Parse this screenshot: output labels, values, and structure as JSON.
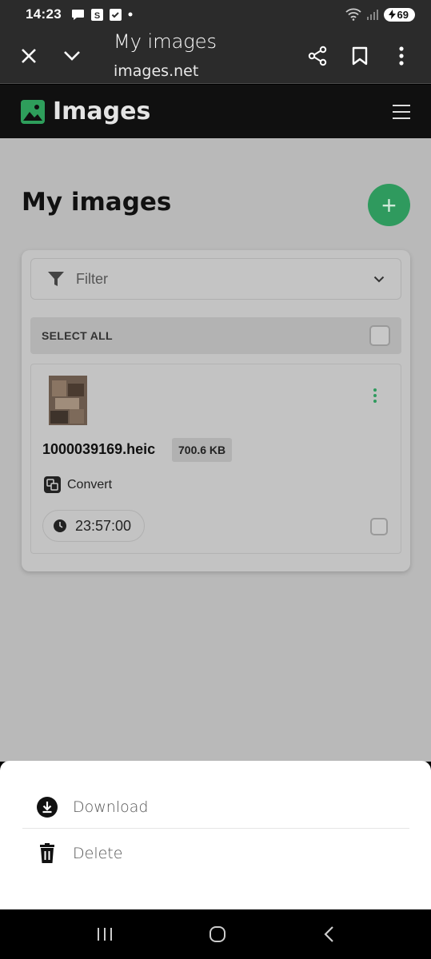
{
  "status_bar": {
    "time": "14:23",
    "battery": "69"
  },
  "browser": {
    "title": "My images",
    "url": "images.net"
  },
  "site": {
    "brand": "Images"
  },
  "page": {
    "heading": "My images",
    "fab_label": "+",
    "filter": {
      "label": "Filter"
    },
    "select_all": {
      "label": "SELECT ALL"
    },
    "item": {
      "filename": "1000039169.heic",
      "size": "700.6 KB",
      "action": "Convert",
      "timer": "23:57:00"
    }
  },
  "sheet": {
    "items": [
      {
        "label": "Download",
        "icon": "download-icon"
      },
      {
        "label": "Delete",
        "icon": "trash-icon"
      }
    ]
  },
  "colors": {
    "accent": "#2f9a5e",
    "overlay": "#b9b9b9",
    "header": "#101010",
    "browser": "#2b2b2b"
  }
}
